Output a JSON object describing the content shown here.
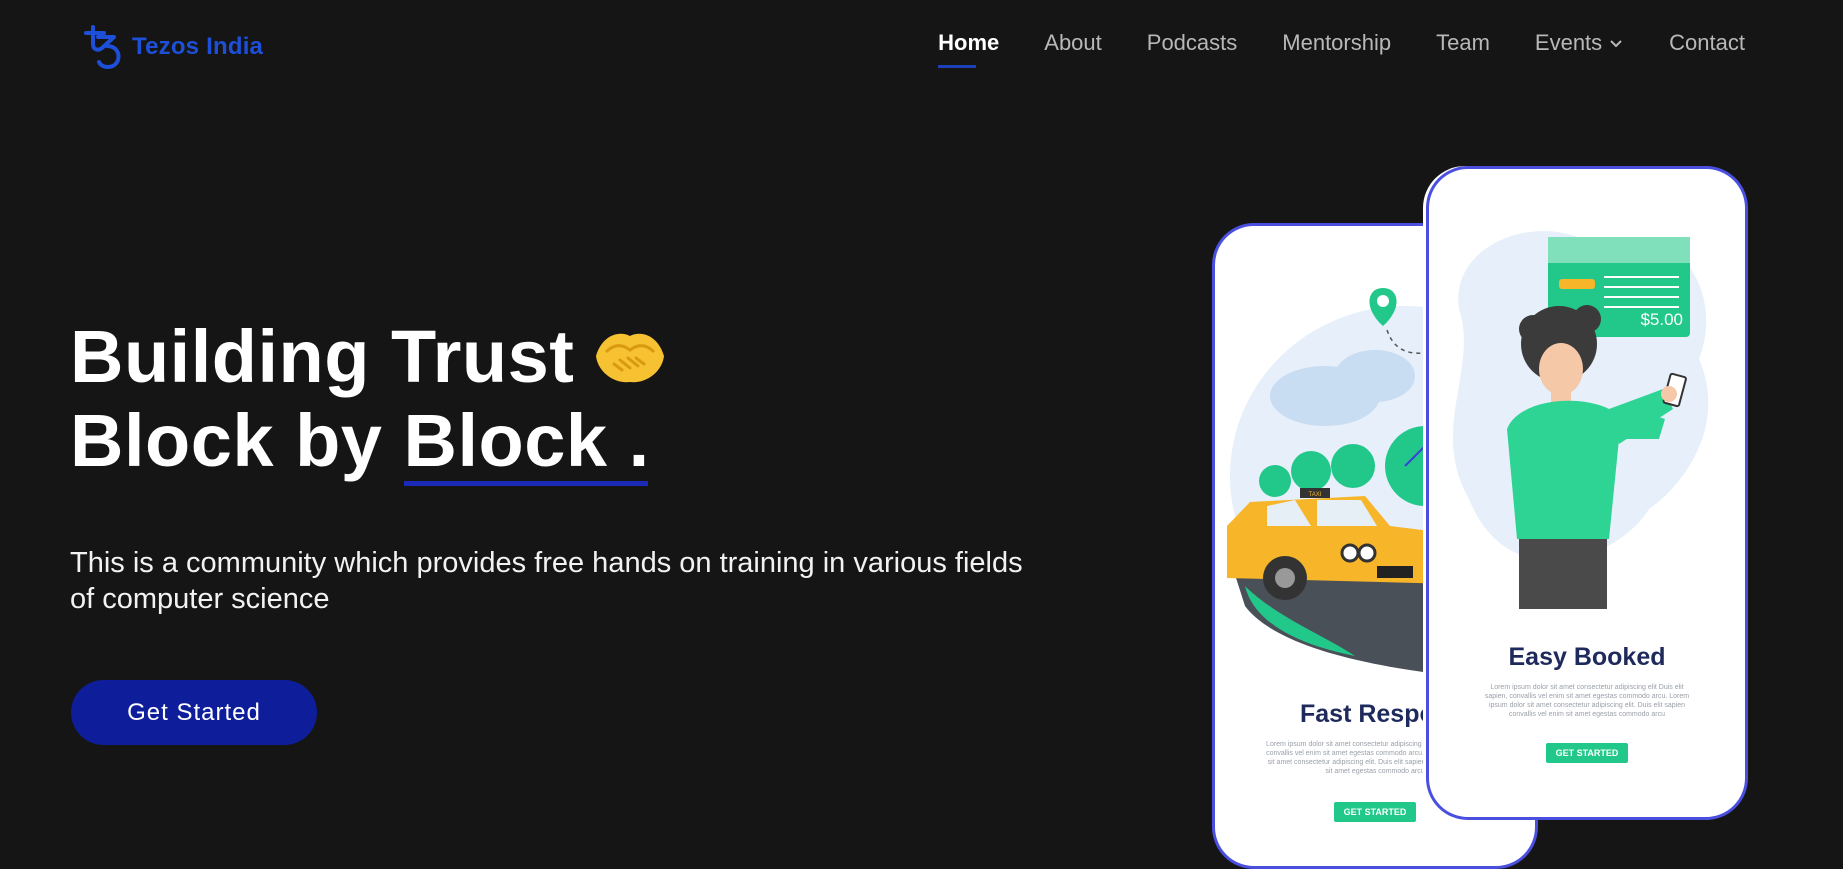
{
  "brand": {
    "name": "Tezos India"
  },
  "nav": {
    "items": [
      {
        "label": "Home"
      },
      {
        "label": "About"
      },
      {
        "label": "Podcasts"
      },
      {
        "label": "Mentorship"
      },
      {
        "label": "Team"
      },
      {
        "label": "Events"
      },
      {
        "label": "Contact"
      }
    ]
  },
  "hero": {
    "title_line1": "Building Trust",
    "title_line2_a": "Block by",
    "title_line2_b": "Block",
    "title_line2_c": ".",
    "description": "This is a community which provides free hands on training in various fields of computer science",
    "cta": "Get Started"
  },
  "phones": {
    "back": {
      "title": "Fast Respon",
      "button": "GET STARTED",
      "taxi_sign": "TAXI",
      "lorem": "Lorem ipsum dolor sit amet consectetur adipiscing elit Duis elit sapien, convallis vel enim sit amet egestas commodo arcu. Lorem ipsum dolor sit amet consectetur adipiscing elit. Duis elit sapien convallis vel enim sit amet egestas commodo arcu"
    },
    "front": {
      "title": "Easy Booked",
      "button": "GET STARTED",
      "price": "$5.00",
      "lorem": "Lorem ipsum dolor sit amet consectetur adipiscing elit Duis elit sapien, convallis vel enim sit amet egestas commodo arcu. Lorem ipsum dolor sit amet consectetur adipiscing elit. Duis elit sapien convallis vel enim sit amet egestas commodo arcu"
    }
  },
  "colors": {
    "background": "#151515",
    "brand": "#1d4fd8",
    "cta": "#0e1e9b",
    "phone_border": "#4a4fe0",
    "accent_green": "#22c88a"
  },
  "icons": {
    "logo": "tezos-logo-icon",
    "events_dropdown": "chevron-down-icon",
    "emoji": "handshake-icon"
  }
}
